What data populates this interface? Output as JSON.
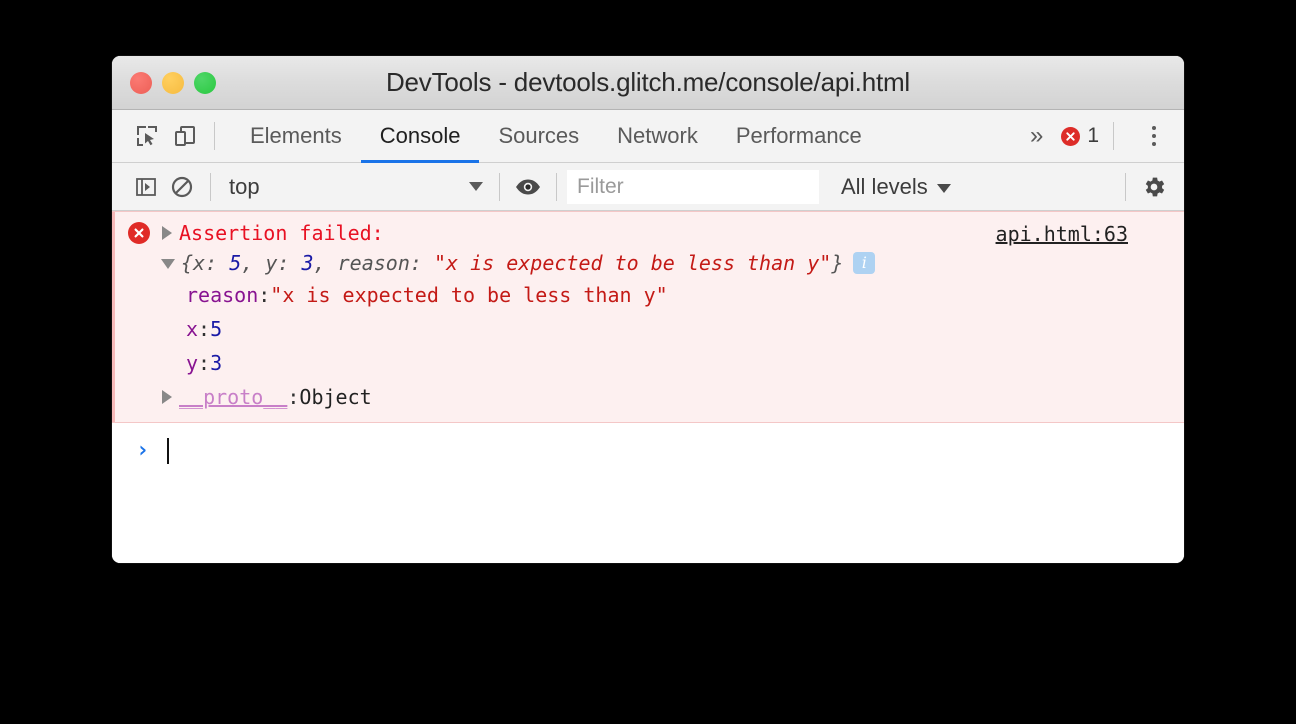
{
  "window": {
    "title": "DevTools - devtools.glitch.me/console/api.html",
    "traffic_lights": [
      "close",
      "minimize",
      "zoom"
    ]
  },
  "tabstrip": {
    "inspect_icon": "inspect-element-icon",
    "device_icon": "device-toolbar-icon",
    "tabs": [
      {
        "label": "Elements",
        "active": false
      },
      {
        "label": "Console",
        "active": true
      },
      {
        "label": "Sources",
        "active": false
      },
      {
        "label": "Network",
        "active": false
      },
      {
        "label": "Performance",
        "active": false
      }
    ],
    "more_tabs": "»",
    "error_count": "1",
    "error_icon": "error-circle-icon",
    "menu_icon": "kebab-menu-icon"
  },
  "console_toolbar": {
    "sidebar_icon": "console-sidebar-icon",
    "clear_icon": "clear-console-icon",
    "context": "top",
    "eye_icon": "live-expression-icon",
    "filter_placeholder": "Filter",
    "filter_value": "",
    "levels_label": "All levels",
    "settings_icon": "gear-icon"
  },
  "console_messages": [
    {
      "type": "error",
      "icon": "error-circle-icon",
      "title": "Assertion failed:",
      "source": "api.html:63",
      "preview": {
        "open_brace": "{",
        "parts": [
          {
            "key": "x",
            "sep": ": ",
            "value": "5",
            "kind": "number",
            "trail": ", "
          },
          {
            "key": "y",
            "sep": ": ",
            "value": "3",
            "kind": "number",
            "trail": ", "
          },
          {
            "key": "reason",
            "sep": ": ",
            "value": "\"x is expected to be less than y\"",
            "kind": "string",
            "trail": ""
          }
        ],
        "close_brace": "}",
        "badge": "i"
      },
      "properties": [
        {
          "name": "reason",
          "sep": ": ",
          "value": "\"x is expected to be less than y\"",
          "kind": "string"
        },
        {
          "name": "x",
          "sep": ": ",
          "value": "5",
          "kind": "number"
        },
        {
          "name": "y",
          "sep": ": ",
          "value": "3",
          "kind": "number"
        },
        {
          "name": "__proto__",
          "sep": ": ",
          "value": "Object",
          "kind": "object"
        }
      ]
    }
  ],
  "prompt": {
    "chevron": "›",
    "input_value": ""
  },
  "colors": {
    "accent_blue": "#1a73e8",
    "error_red": "#e81123",
    "error_bg": "#fdf0f0",
    "string_red": "#c41a16",
    "number_blue": "#1a1aa6",
    "property_purple": "#881391",
    "proto_purple": "#c87fc8",
    "badge_blue": "#aed2f2",
    "page_bg": "#000000"
  }
}
